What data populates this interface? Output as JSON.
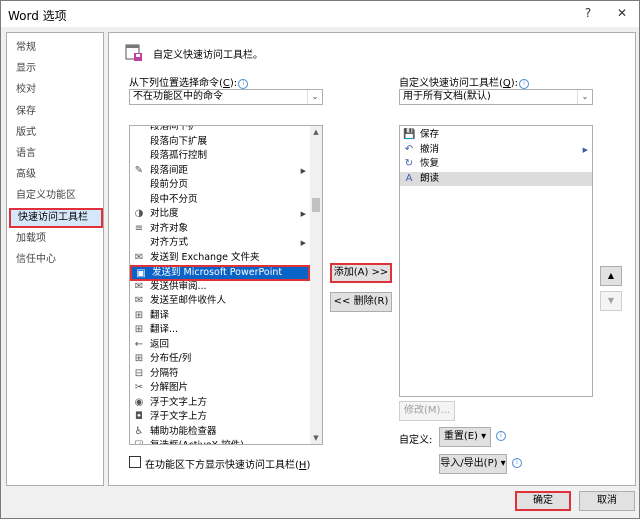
{
  "window": {
    "title": "Word 选项",
    "help": "?",
    "close": "✕"
  },
  "nav": {
    "items": [
      {
        "label": "常规"
      },
      {
        "label": "显示"
      },
      {
        "label": "校对"
      },
      {
        "label": "保存"
      },
      {
        "label": "版式"
      },
      {
        "label": "语言"
      },
      {
        "label": "高级"
      },
      {
        "label": "自定义功能区"
      },
      {
        "label": "快速访问工具栏",
        "selected": true
      },
      {
        "label": "加载项"
      },
      {
        "label": "信任中心"
      }
    ]
  },
  "header": {
    "title": "自定义快速访问工具栏。"
  },
  "left": {
    "choose_label": "从下列位置选择命令(",
    "choose_key": "C",
    "choose_tail": "):",
    "choose_value": "不在功能区中的命令",
    "commands": [
      {
        "label": "段落间下扩",
        "icon": ""
      },
      {
        "label": "段落向下扩展",
        "icon": ""
      },
      {
        "label": "段落孤行控制",
        "icon": ""
      },
      {
        "label": "段落间距",
        "icon": "✎",
        "sub": "▶"
      },
      {
        "label": "段前分页",
        "icon": ""
      },
      {
        "label": "段中不分页",
        "icon": ""
      },
      {
        "label": "对比度",
        "icon": "◑",
        "sub": "▶"
      },
      {
        "label": "对齐对象",
        "icon": "≡"
      },
      {
        "label": "对齐方式",
        "icon": "",
        "sub": "▶"
      },
      {
        "label": "发送到 Exchange 文件夹",
        "icon": "✉"
      },
      {
        "label": "发送到 Microsoft PowerPoint",
        "icon": "▣",
        "highlighted": true
      },
      {
        "label": "发送供审阅...",
        "icon": "✉"
      },
      {
        "label": "发送至邮件收件人",
        "icon": "✉"
      },
      {
        "label": "翻译",
        "icon": "⊞"
      },
      {
        "label": "翻译...",
        "icon": "⊞"
      },
      {
        "label": "返回",
        "icon": "←"
      },
      {
        "label": "分布任/列",
        "icon": "⊞"
      },
      {
        "label": "分隔符",
        "icon": "⊟"
      },
      {
        "label": "分解图片",
        "icon": "✂"
      },
      {
        "label": "浮于文字上方",
        "icon": "◉"
      },
      {
        "label": "浮于文字上方",
        "icon": "◘"
      },
      {
        "label": "辅助功能检查器",
        "icon": "♿"
      },
      {
        "label": "复选框(ActiveX 控件)",
        "icon": "☑"
      }
    ],
    "checkbox_label": "在功能区下方显示快速访问工具栏(",
    "checkbox_key": "H",
    "checkbox_tail": ")"
  },
  "middle": {
    "add_label": "添加(A) >>",
    "remove_label": "<< 删除(R)"
  },
  "right": {
    "customize_label": "自定义快速访问工具栏(",
    "customize_key": "Q",
    "customize_tail": "):",
    "customize_value": "用于所有文档(默认)",
    "items": [
      {
        "label": "保存",
        "icon": "💾"
      },
      {
        "label": "撤消",
        "icon": "↶",
        "sub": "▶"
      },
      {
        "label": "恢复",
        "icon": "↻"
      },
      {
        "label": "朗读",
        "icon": "A",
        "selected": true
      }
    ],
    "modify_label": "修改(M)...",
    "customizations_label": "自定义:",
    "reset_label": "重置(E) ▾",
    "importexport_label": "导入/导出(P) ▾",
    "up_icon": "▲",
    "down_icon": "▼"
  },
  "footer": {
    "ok_label": "确定",
    "cancel_label": "取消"
  }
}
